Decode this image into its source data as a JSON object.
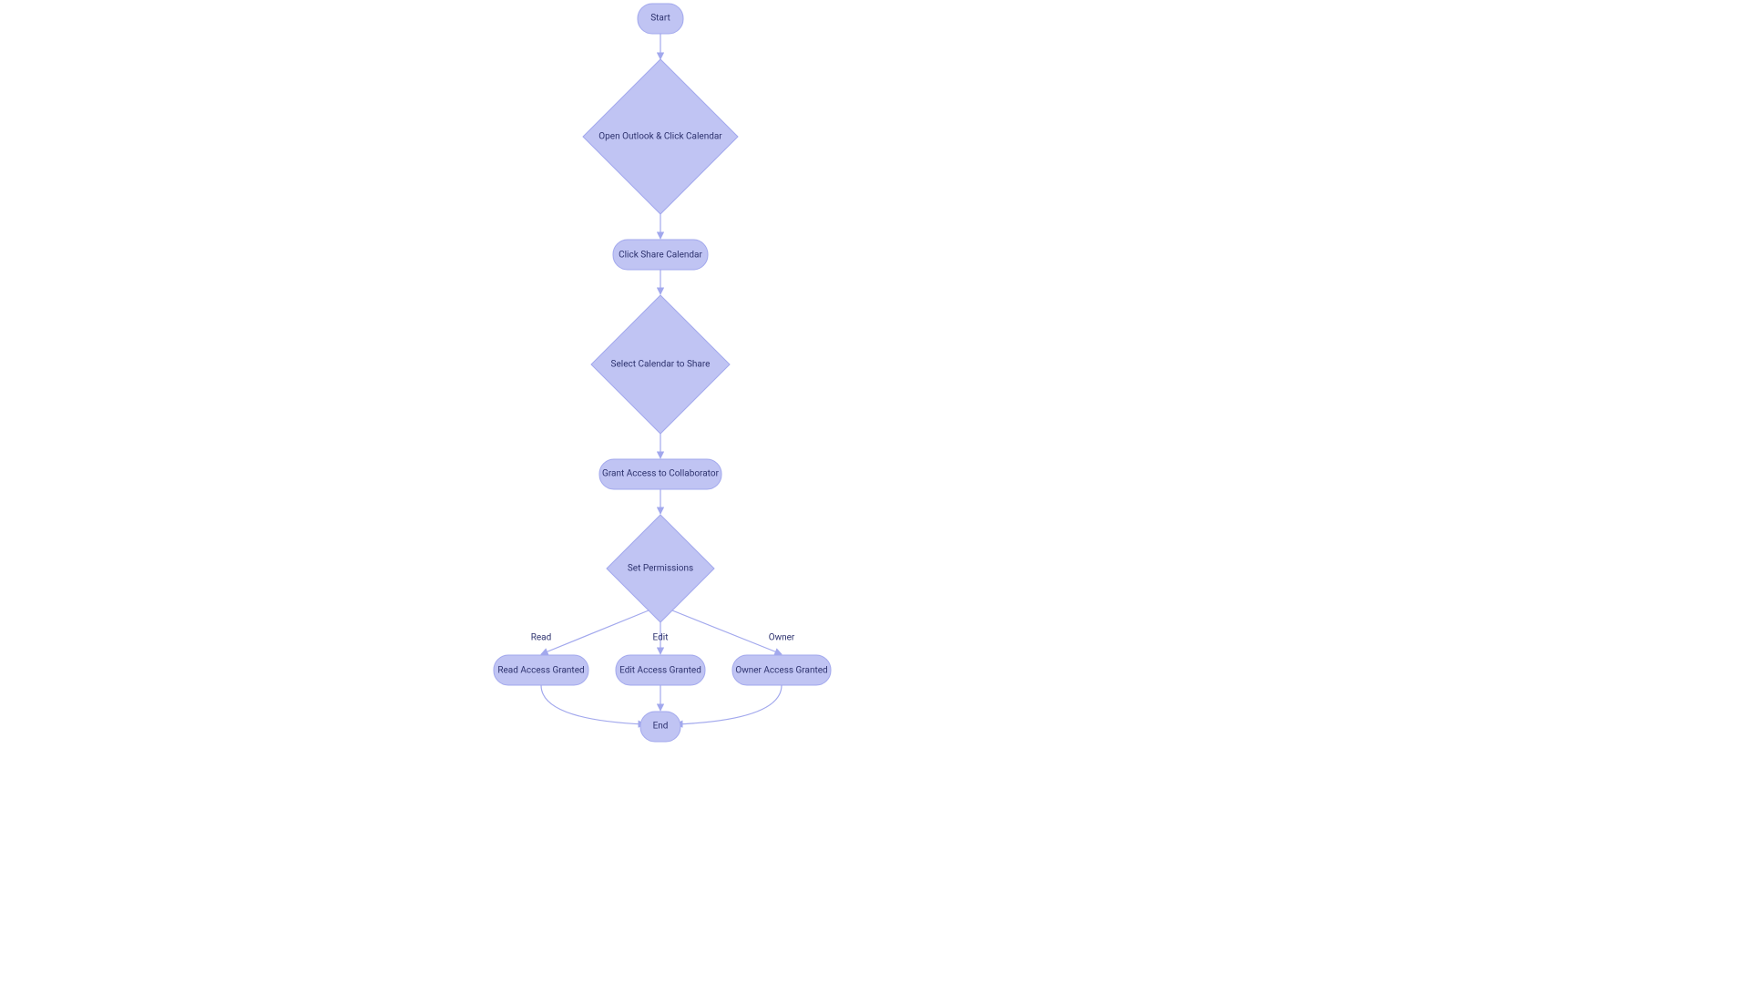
{
  "nodes": {
    "start": "Start",
    "openOutlook": "Open Outlook & Click Calendar",
    "clickShare": "Click Share Calendar",
    "selectCalendar": "Select Calendar to Share",
    "grantAccess": "Grant Access to Collaborator",
    "setPermissions": "Set Permissions",
    "readGranted": "Read Access Granted",
    "editGranted": "Edit Access Granted",
    "ownerGranted": "Owner Access Granted",
    "end": "End"
  },
  "edgeLabels": {
    "read": "Read",
    "edit": "Edit",
    "owner": "Owner"
  },
  "colors": {
    "nodeFill": "#c0c4f3",
    "nodeStroke": "#a2a8ed",
    "text": "#2d326e"
  }
}
